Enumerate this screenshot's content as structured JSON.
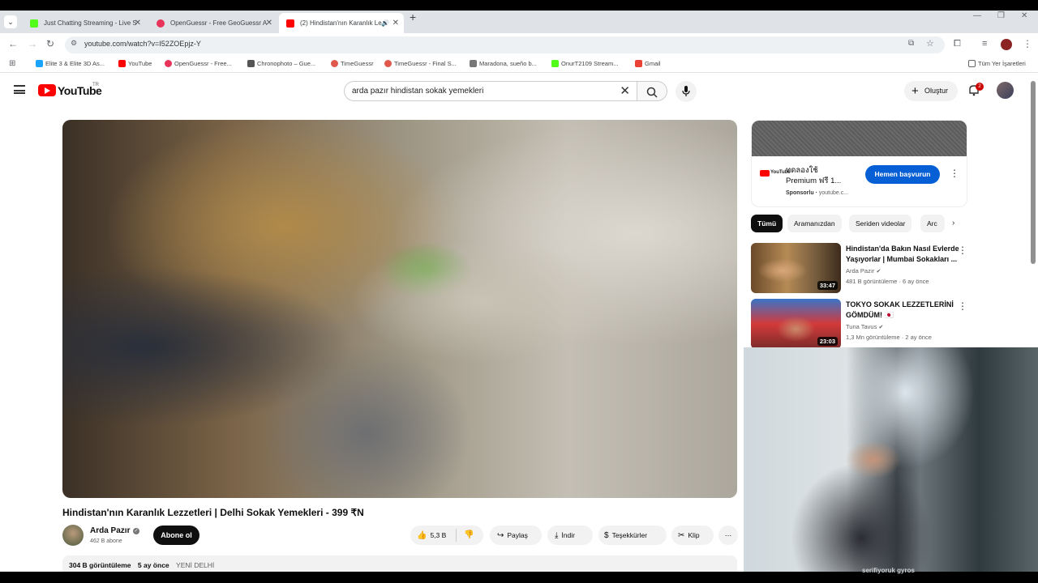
{
  "browser": {
    "tabs": [
      {
        "label": "Just Chatting Streaming - Live S",
        "color": "#53fc18"
      },
      {
        "label": "OpenGuessr - Free GeoGuessr A",
        "color": "#e8335a"
      },
      {
        "label": "(2) Hindistan'nın Karanlık Le",
        "color": "#ff0000"
      }
    ],
    "url": "youtube.com/watch?v=I52ZOEpjz-Y",
    "bookmarks": [
      {
        "label": "Elite 3 & Elite 3D As...",
        "color": "#1aa3ff"
      },
      {
        "label": "YouTube",
        "color": "#ff0000"
      },
      {
        "label": "OpenGuessr - Free...",
        "color": "#e8335a"
      },
      {
        "label": "Chronophoto – Gue...",
        "color": "#555555"
      },
      {
        "label": "TimeGuessr",
        "color": "#e0584b"
      },
      {
        "label": "TimeGuessr - Final S...",
        "color": "#e0584b"
      },
      {
        "label": "Maradona, sueño b...",
        "color": "#777777"
      },
      {
        "label": "OnurT2109 Stream...",
        "color": "#53fc18"
      },
      {
        "label": "Gmail",
        "color": "#ea4335"
      }
    ],
    "all_bookmarks": "Tüm Yer İşaretleri"
  },
  "header": {
    "logo": "YouTube",
    "region": "TR",
    "search_query": "arda pazır hindistan sokak yemekleri",
    "create_label": "Oluştur",
    "notif_count": "2"
  },
  "video": {
    "title": "Hindistan'nın Karanlık Lezzetleri | Delhi Sokak Yemekleri - 399 ₹N",
    "channel": "Arda Pazır",
    "subscribers": "462 B abone",
    "subscribe_label": "Abone ol",
    "likes": "5,3 B",
    "share": "Paylaş",
    "download": "İndir",
    "thanks": "Teşekkürler",
    "clip": "Klip",
    "views": "304 B görüntüleme",
    "age": "5 ay önce",
    "hashtag": "YENİ DELHİ"
  },
  "ad": {
    "logo_text": "YouTube",
    "title": "ทดลองใช้ Premium ฟรี 1...",
    "sponsored": "Sponsorlu",
    "domain": "youtube.c...",
    "cta": "Hemen başvurun"
  },
  "chips": [
    "Tümü",
    "Aramanızdan",
    "Seriden videolar",
    "Arc"
  ],
  "recommendations": [
    {
      "title": "Hindistan'da Bakın Nasıl Evlerde Yaşıyorlar | Mumbai Sokakları ...",
      "channel": "Arda Pazır",
      "meta": "481 B görüntüleme · 6 ay önce",
      "duration": "33:47"
    },
    {
      "title": "TOKYO SOKAK LEZZETLERİNİ GÖMDÜM! 🇯🇵",
      "channel": "Tuna Tavus",
      "meta": "1,3 Mn görüntüleme · 2 ay önce",
      "duration": "23:03"
    }
  ],
  "webcam_caption": "serifiyoruk gyros"
}
